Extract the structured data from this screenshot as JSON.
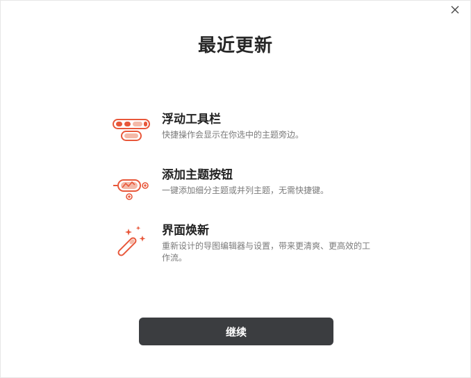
{
  "dialog": {
    "title": "最近更新",
    "close_icon": "close-icon"
  },
  "features": [
    {
      "icon": "floating-toolbar-icon",
      "name": "浮动工具栏",
      "desc": "快捷操作会显示在你选中的主题旁边。"
    },
    {
      "icon": "add-topic-button-icon",
      "name": "添加主题按钮",
      "desc": "一键添加细分主题或并列主题，无需快捷键。"
    },
    {
      "icon": "magic-wand-icon",
      "name": "界面焕新",
      "desc": "重新设计的导图编辑器与设置，带来更清爽、更高效的工作流。"
    }
  ],
  "actions": {
    "continue_label": "继续"
  },
  "colors": {
    "accent": "#e8573a",
    "button_bg": "#3b3d40",
    "button_text": "#ffffff",
    "title_text": "#262626",
    "desc_text": "#7a7a7a"
  }
}
